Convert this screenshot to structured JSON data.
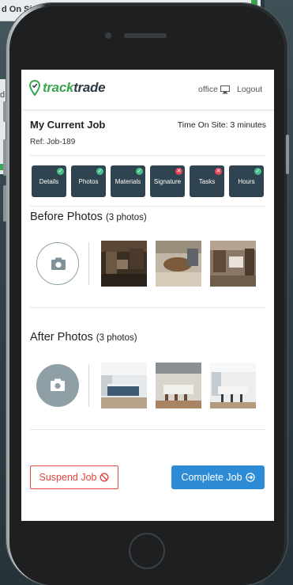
{
  "background": {
    "sheet_label": "d On Si",
    "sheet2_label": "d"
  },
  "app": {
    "logo_track": "track",
    "logo_trade": "trade",
    "office_label": "office",
    "logout_label": "Logout"
  },
  "job": {
    "title": "My Current Job",
    "ref": "Ref: Job-189",
    "time_on_site": "Time On Site: 3 minutes"
  },
  "tabs": [
    {
      "label": "Details",
      "status": "complete"
    },
    {
      "label": "Photos",
      "status": "complete"
    },
    {
      "label": "Materials",
      "status": "complete"
    },
    {
      "label": "Signature",
      "status": "incomplete"
    },
    {
      "label": "Tasks",
      "status": "incomplete"
    },
    {
      "label": "Hours",
      "status": "complete"
    }
  ],
  "before": {
    "title": "Before Photos",
    "count": "(3 photos)"
  },
  "after": {
    "title": "After Photos",
    "count": "(3 photos)"
  },
  "actions": {
    "suspend_label": "Suspend Job",
    "complete_label": "Complete Job"
  },
  "colors": {
    "brand_green": "#3aa651",
    "tab_bg": "#2f4350",
    "ok": "#46c08a",
    "bad": "#e2495b",
    "suspend": "#e0463d",
    "complete": "#2e8cd6"
  }
}
